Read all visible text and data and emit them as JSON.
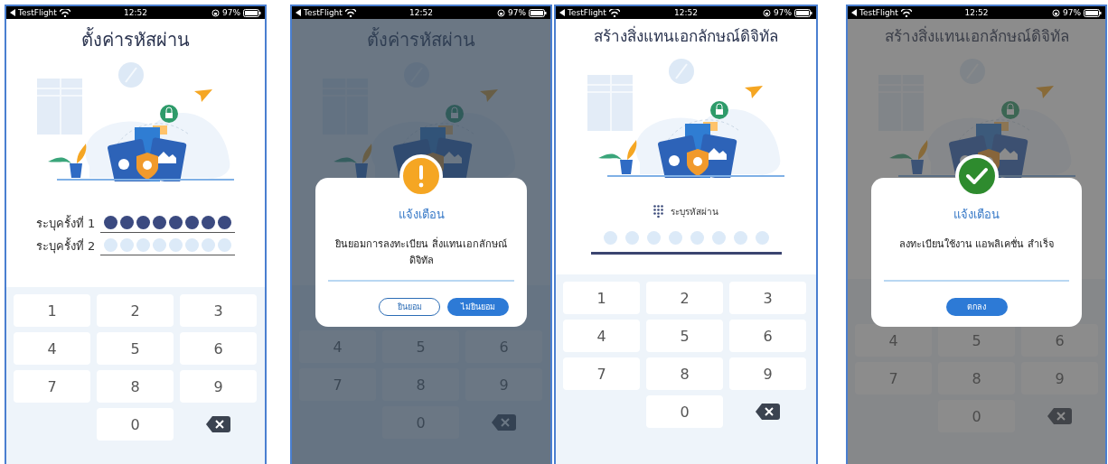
{
  "screens": [
    {
      "status_bar": {
        "app": "TestFlight",
        "time": "12:52",
        "battery": "97%"
      },
      "title": "ตั้งค่ารหัสผ่าน",
      "pin_rows": [
        {
          "label": "ระบุครั้งที่ 1",
          "dots": [
            {
              "filled": true
            },
            {
              "filled": true
            },
            {
              "filled": true
            },
            {
              "filled": true
            },
            {
              "filled": true
            },
            {
              "filled": true
            },
            {
              "filled": true
            },
            {
              "filled": true
            }
          ]
        },
        {
          "label": "ระบุครั้งที่ 2",
          "dots": [
            {
              "filled": false
            },
            {
              "filled": false
            },
            {
              "filled": false
            },
            {
              "filled": false
            },
            {
              "filled": false
            },
            {
              "filled": false
            },
            {
              "filled": false
            },
            {
              "filled": false
            }
          ]
        }
      ],
      "keypad": [
        {
          "kind": "digit",
          "label": "1"
        },
        {
          "kind": "digit",
          "label": "2"
        },
        {
          "kind": "digit",
          "label": "3"
        },
        {
          "kind": "digit",
          "label": "4"
        },
        {
          "kind": "digit",
          "label": "5"
        },
        {
          "kind": "digit",
          "label": "6"
        },
        {
          "kind": "digit",
          "label": "7"
        },
        {
          "kind": "digit",
          "label": "8"
        },
        {
          "kind": "digit",
          "label": "9"
        },
        {
          "kind": "blank"
        },
        {
          "kind": "digit",
          "label": "0"
        },
        {
          "kind": "backspace"
        }
      ]
    },
    {
      "status_bar": {
        "app": "TestFlight",
        "time": "12:52",
        "battery": "97%"
      },
      "title": "ตั้งค่ารหัสผ่าน",
      "keypad": [
        {
          "kind": "digit",
          "label": "4"
        },
        {
          "kind": "digit",
          "label": "5"
        },
        {
          "kind": "digit",
          "label": "6"
        },
        {
          "kind": "digit",
          "label": "7"
        },
        {
          "kind": "digit",
          "label": "8"
        },
        {
          "kind": "digit",
          "label": "9"
        },
        {
          "kind": "blank"
        },
        {
          "kind": "digit",
          "label": "0"
        },
        {
          "kind": "backspace"
        }
      ],
      "dialog": {
        "kind": "warning",
        "title": "แจ้งเตือน",
        "message": "ยินยอมการลงทะเบียน สิ่งแทนเอกลักษณ์ดิจิทัล",
        "buttons": [
          {
            "label": "ยินยอม",
            "kind": "outline"
          },
          {
            "label": "ไม่ยินยอม",
            "kind": "primary"
          }
        ]
      }
    },
    {
      "status_bar": {
        "app": "TestFlight",
        "time": "12:52",
        "battery": "97%"
      },
      "title": "สร้างสิ่งแทนเอกลักษณ์ดิจิทัล",
      "pin_field": {
        "label": "ระบุรหัสผ่าน",
        "dots": [
          {
            "filled": false
          },
          {
            "filled": false
          },
          {
            "filled": false
          },
          {
            "filled": false
          },
          {
            "filled": false
          },
          {
            "filled": false
          },
          {
            "filled": false
          },
          {
            "filled": false
          }
        ]
      },
      "keypad": [
        {
          "kind": "digit",
          "label": "1"
        },
        {
          "kind": "digit",
          "label": "2"
        },
        {
          "kind": "digit",
          "label": "3"
        },
        {
          "kind": "digit",
          "label": "4"
        },
        {
          "kind": "digit",
          "label": "5"
        },
        {
          "kind": "digit",
          "label": "6"
        },
        {
          "kind": "digit",
          "label": "7"
        },
        {
          "kind": "digit",
          "label": "8"
        },
        {
          "kind": "digit",
          "label": "9"
        },
        {
          "kind": "blank"
        },
        {
          "kind": "digit",
          "label": "0"
        },
        {
          "kind": "backspace"
        }
      ]
    },
    {
      "status_bar": {
        "app": "TestFlight",
        "time": "12:52",
        "battery": "97%"
      },
      "title": "สร้างสิ่งแทนเอกลักษณ์ดิจิทัล",
      "keypad": [
        {
          "kind": "digit",
          "label": "4"
        },
        {
          "kind": "digit",
          "label": "5"
        },
        {
          "kind": "digit",
          "label": "6"
        },
        {
          "kind": "digit",
          "label": "7"
        },
        {
          "kind": "digit",
          "label": "8"
        },
        {
          "kind": "digit",
          "label": "9"
        },
        {
          "kind": "blank"
        },
        {
          "kind": "digit",
          "label": "0"
        },
        {
          "kind": "backspace"
        }
      ],
      "dialog": {
        "kind": "success",
        "title": "แจ้งเตือน",
        "message": "ลงทะเบียนใช้งาน แอพลิเคชั่น สำเร็จ",
        "buttons": [
          {
            "label": "ตกลง",
            "kind": "primary"
          }
        ]
      }
    }
  ]
}
